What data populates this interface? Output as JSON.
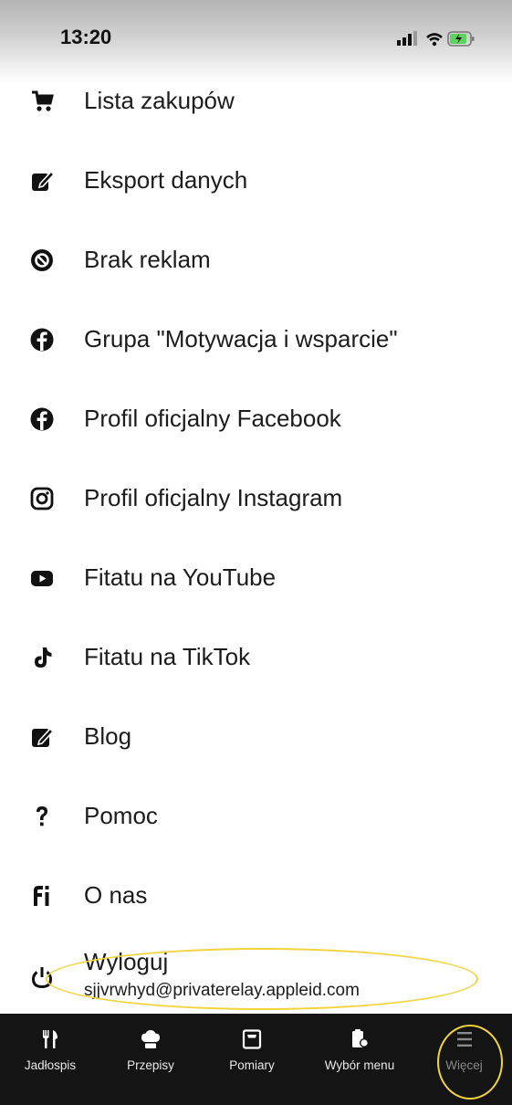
{
  "status_bar": {
    "time": "13:20"
  },
  "menu": {
    "items": [
      {
        "label": "Lista zakupów",
        "icon": "shopping-cart-icon"
      },
      {
        "label": "Eksport danych",
        "icon": "export-edit-icon"
      },
      {
        "label": "Brak reklam",
        "icon": "no-ads-icon"
      },
      {
        "label": "Grupa \"Motywacja i wsparcie\"",
        "icon": "facebook-icon"
      },
      {
        "label": "Profil oficjalny Facebook",
        "icon": "facebook-icon"
      },
      {
        "label": "Profil oficjalny Instagram",
        "icon": "instagram-icon"
      },
      {
        "label": "Fitatu na YouTube",
        "icon": "youtube-icon"
      },
      {
        "label": "Fitatu na TikTok",
        "icon": "tiktok-icon"
      },
      {
        "label": "Blog",
        "icon": "blog-edit-icon"
      },
      {
        "label": "Pomoc",
        "icon": "question-icon"
      },
      {
        "label": "O nas",
        "icon": "fitatu-logo-icon"
      }
    ],
    "logout": {
      "label": "Wyloguj",
      "email": "sjjvrwhyd@privaterelay.appleid.com",
      "icon": "power-icon"
    }
  },
  "nav": {
    "tabs": [
      {
        "label": "Jadłospis",
        "icon": "fork-knife-icon"
      },
      {
        "label": "Przepisy",
        "icon": "chef-hat-icon"
      },
      {
        "label": "Pomiary",
        "icon": "measurement-icon"
      },
      {
        "label": "Wybór menu",
        "icon": "menu-choice-icon"
      },
      {
        "label": "Więcej",
        "icon": "hamburger-icon",
        "active": true
      }
    ]
  },
  "colors": {
    "nav_bg": "#141414",
    "annotation": "#f2d33a",
    "text": "#1c1c1c"
  }
}
